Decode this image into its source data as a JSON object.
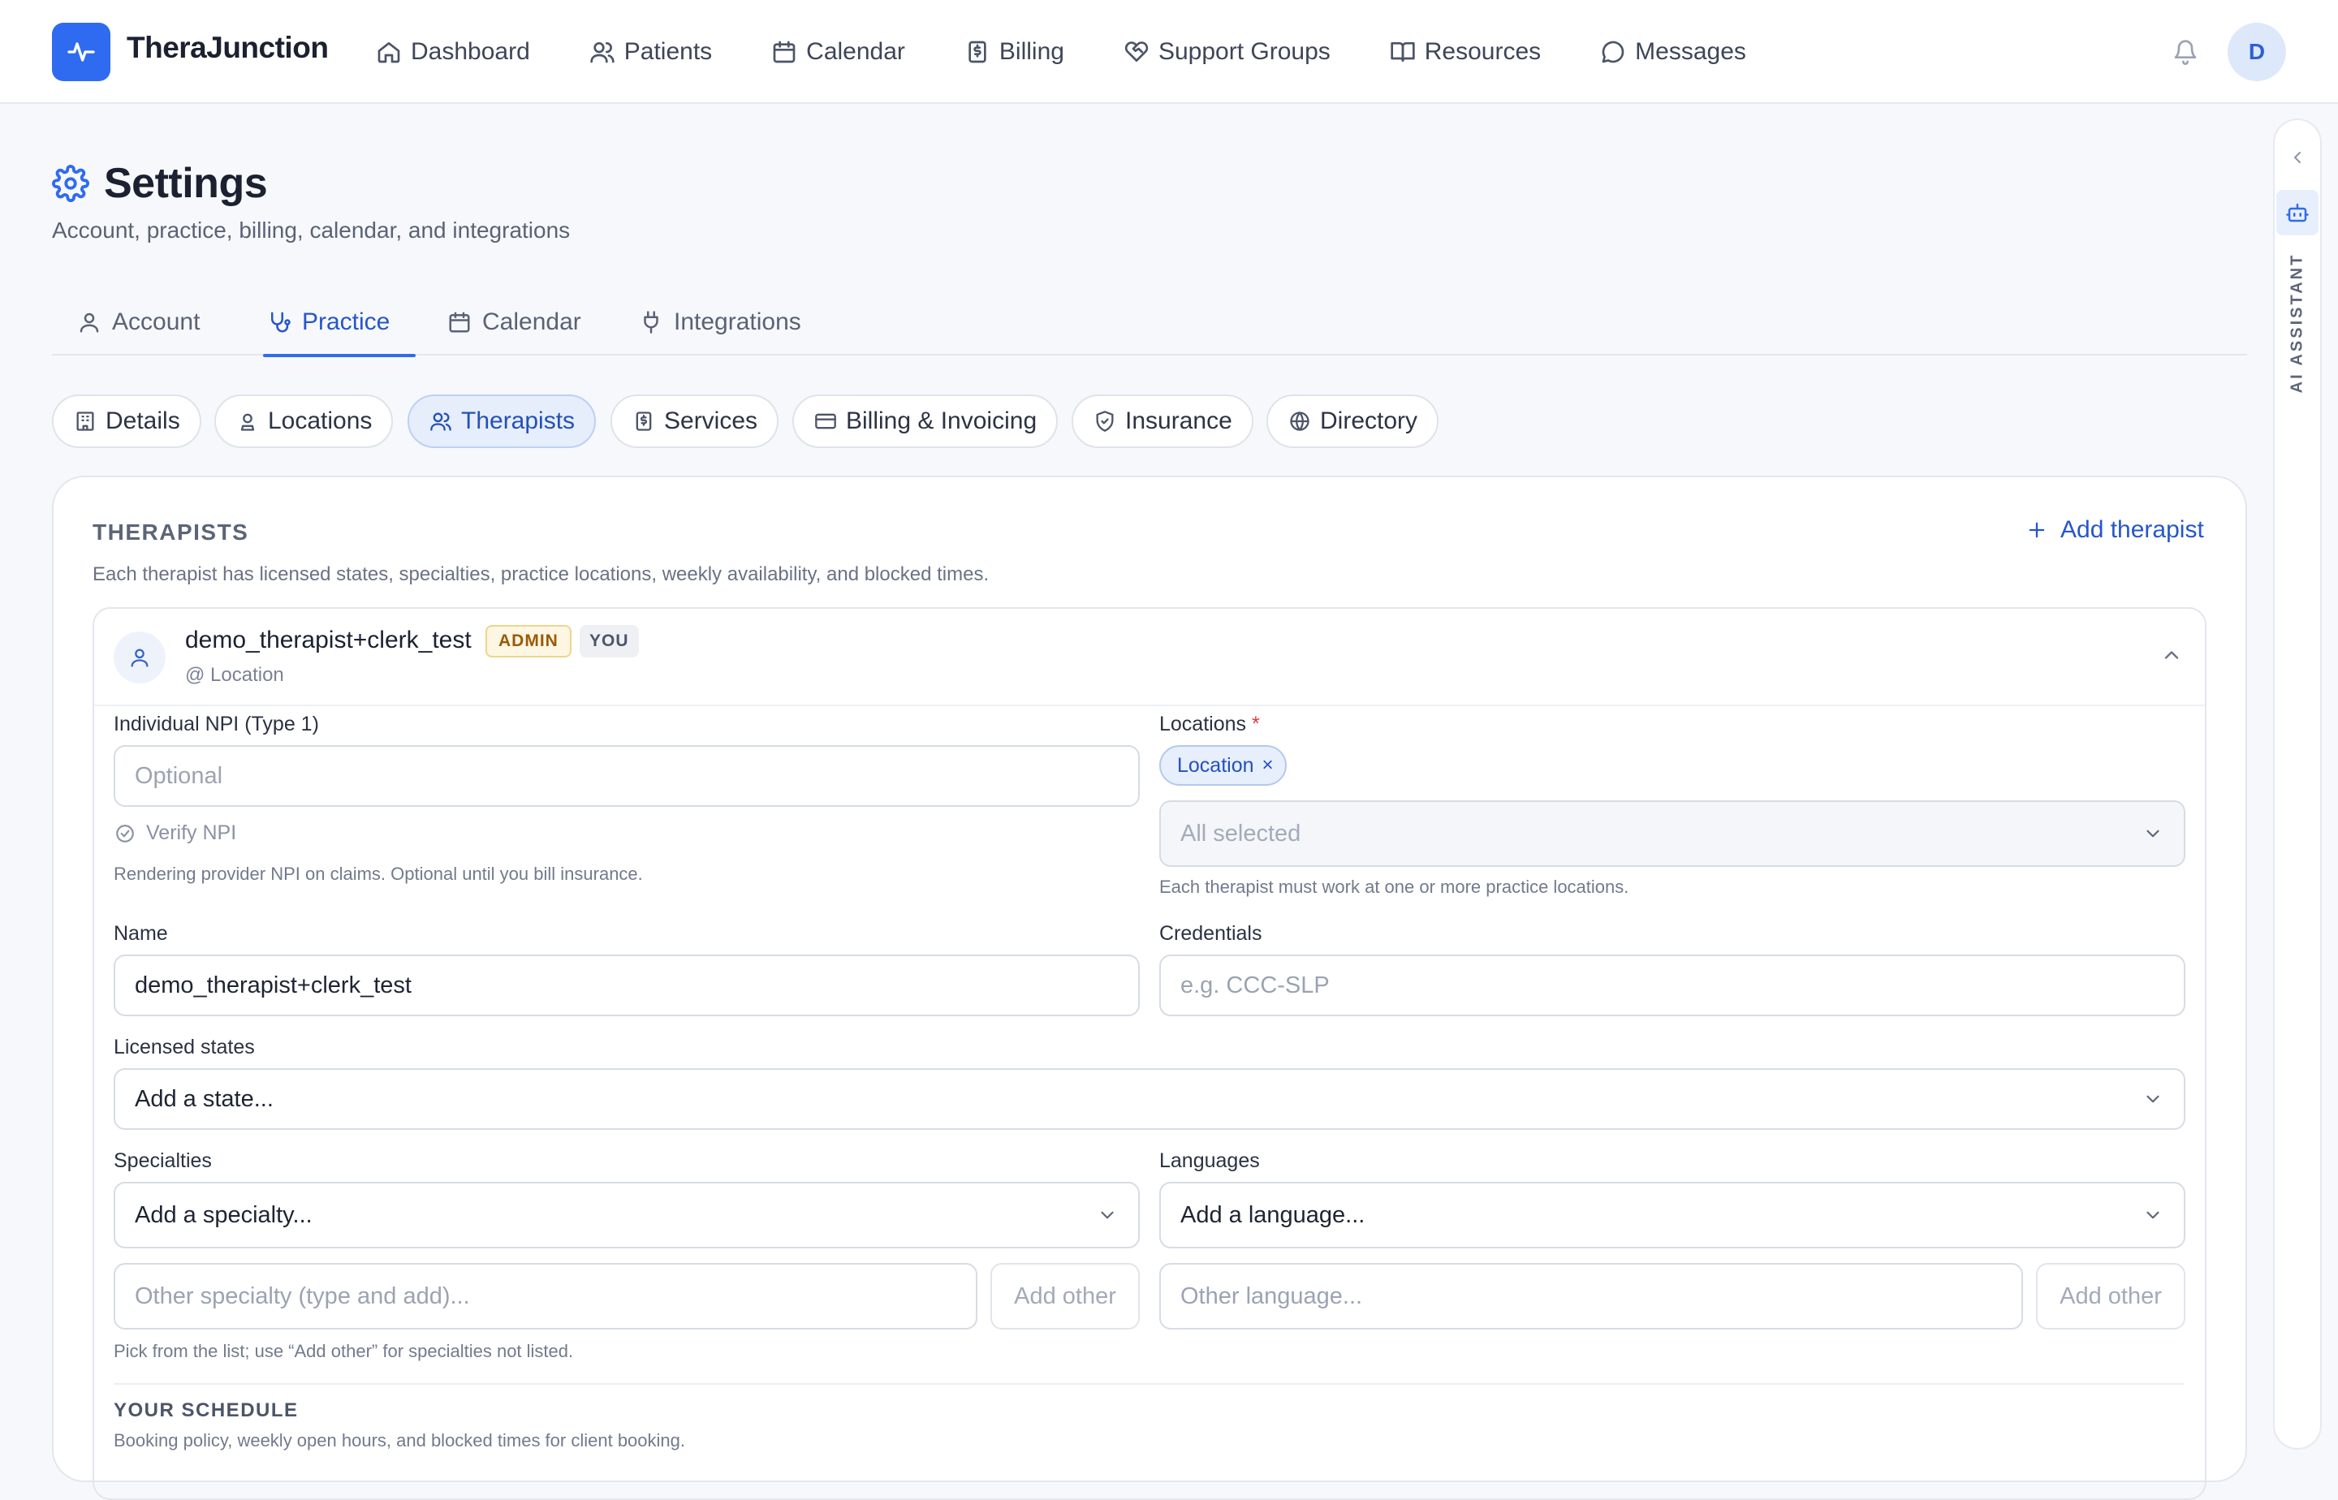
{
  "app": {
    "brand": "TheraJunction",
    "avatar_initial": "D"
  },
  "nav": [
    {
      "label": "Dashboard",
      "icon": "home-icon"
    },
    {
      "label": "Patients",
      "icon": "users-icon"
    },
    {
      "label": "Calendar",
      "icon": "calendar-icon"
    },
    {
      "label": "Billing",
      "icon": "receipt-icon"
    },
    {
      "label": "Support Groups",
      "icon": "heart-handshake-icon"
    },
    {
      "label": "Resources",
      "icon": "book-icon"
    },
    {
      "label": "Messages",
      "icon": "message-icon"
    }
  ],
  "ai_assistant": {
    "label": "AI ASSISTANT"
  },
  "header": {
    "title": "Settings",
    "subtitle": "Account, practice, billing, calendar, and integrations"
  },
  "tabs": [
    {
      "label": "Account",
      "active": false
    },
    {
      "label": "Practice",
      "active": true
    },
    {
      "label": "Calendar",
      "active": false
    },
    {
      "label": "Integrations",
      "active": false
    }
  ],
  "subtabs": [
    {
      "label": "Details",
      "active": false
    },
    {
      "label": "Locations",
      "active": false
    },
    {
      "label": "Therapists",
      "active": true
    },
    {
      "label": "Services",
      "active": false
    },
    {
      "label": "Billing & Invoicing",
      "active": false
    },
    {
      "label": "Insurance",
      "active": false
    },
    {
      "label": "Directory",
      "active": false
    }
  ],
  "therapists": {
    "section_title": "THERAPISTS",
    "section_desc": "Each therapist has licensed states, specialties, practice locations, weekly availability, and blocked times.",
    "add_label": "Add therapist",
    "entry": {
      "name": "demo_therapist+clerk_test",
      "badge_admin": "ADMIN",
      "badge_you": "YOU",
      "location_line": "@ Location"
    },
    "form": {
      "npi": {
        "label": "Individual NPI (Type 1)",
        "placeholder": "Optional",
        "verify_label": "Verify NPI",
        "hint": "Rendering provider NPI on claims. Optional until you bill insurance."
      },
      "locations": {
        "label": "Locations",
        "required_mark": "*",
        "chip": "Location",
        "chip_remove": "×",
        "select_value": "All selected",
        "hint": "Each therapist must work at one or more practice locations."
      },
      "name": {
        "label": "Name",
        "value": "demo_therapist+clerk_test"
      },
      "credentials": {
        "label": "Credentials",
        "placeholder": "e.g. CCC-SLP"
      },
      "licensed_states": {
        "label": "Licensed states",
        "select_value": "Add a state..."
      },
      "specialties": {
        "label": "Specialties",
        "select_value": "Add a specialty...",
        "other_placeholder": "Other specialty (type and add)...",
        "add_other": "Add other",
        "hint": "Pick from the list; use “Add other” for specialties not listed."
      },
      "languages": {
        "label": "Languages",
        "select_value": "Add a language...",
        "other_placeholder": "Other language...",
        "add_other": "Add other"
      }
    },
    "schedule": {
      "title": "YOUR SCHEDULE",
      "desc": "Booking policy, weekly open hours, and blocked times for client booking."
    }
  },
  "colors": {
    "accent": "#2f6bf0",
    "accent_text": "#2656c9",
    "admin_badge": "#9a5a08",
    "required": "#e03b3b"
  }
}
